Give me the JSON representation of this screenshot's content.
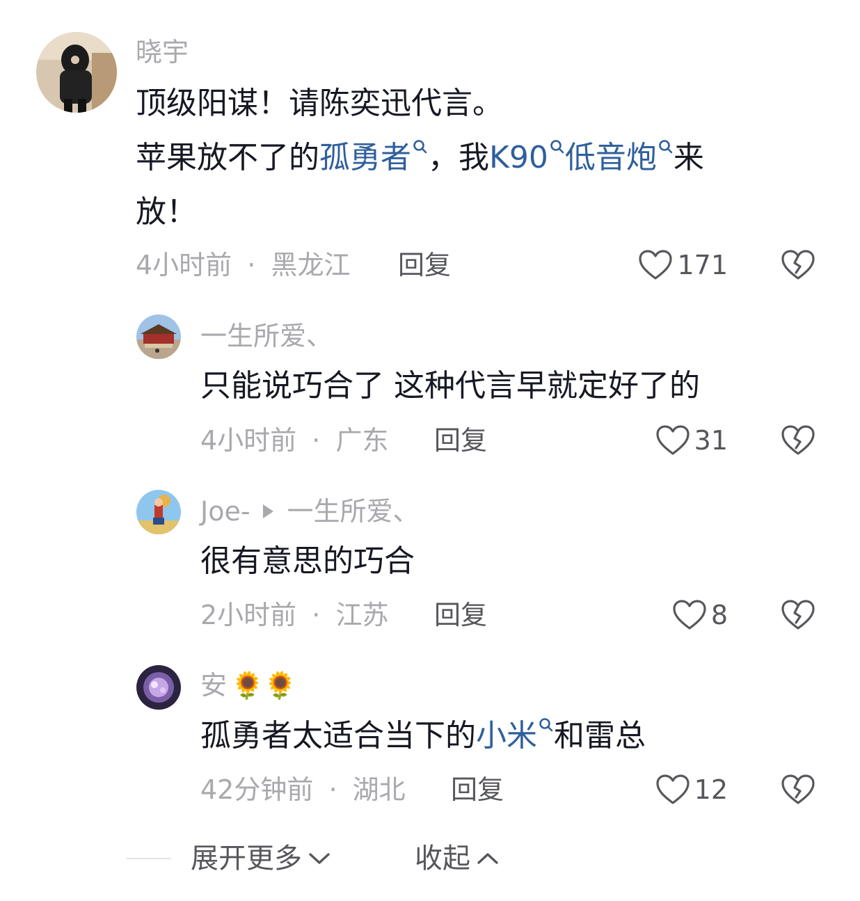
{
  "comments": [
    {
      "username": "晓宇",
      "text_line1": "顶级阳谋！请陈奕迅代言。",
      "text_line2": {
        "a": "苹果放不了的",
        "link1": "孤勇者",
        "b": "，我",
        "link2": "K90",
        "link3": "低音炮",
        "c": "来"
      },
      "text_line3": "放！",
      "time": "4小时前",
      "location": "黑龙江",
      "reply_label": "回复",
      "likes": "171"
    }
  ],
  "replies": [
    {
      "username": "一生所爱、",
      "text": "只能说巧合了 这种代言早就定好了的",
      "time": "4小时前",
      "location": "广东",
      "reply_label": "回复",
      "likes": "31"
    },
    {
      "username": "Joe-",
      "reply_to": "一生所爱、",
      "text": "很有意思的巧合",
      "time": "2小时前",
      "location": "江苏",
      "reply_label": "回复",
      "likes": "8"
    },
    {
      "username": "安",
      "username_emoji": "🌻🌻",
      "text": {
        "a": "孤勇者太适合当下的",
        "link": "小米",
        "b": "和雷总"
      },
      "time": "42分钟前",
      "location": "湖北",
      "reply_label": "回复",
      "likes": "12"
    }
  ],
  "footer": {
    "expand_label": "展开更多",
    "collapse_label": "收起"
  },
  "meta_separator": "·",
  "colors": {
    "link": "#2f5f9c",
    "muted": "#a8a8ad",
    "action": "#56575c",
    "text": "#161823"
  }
}
